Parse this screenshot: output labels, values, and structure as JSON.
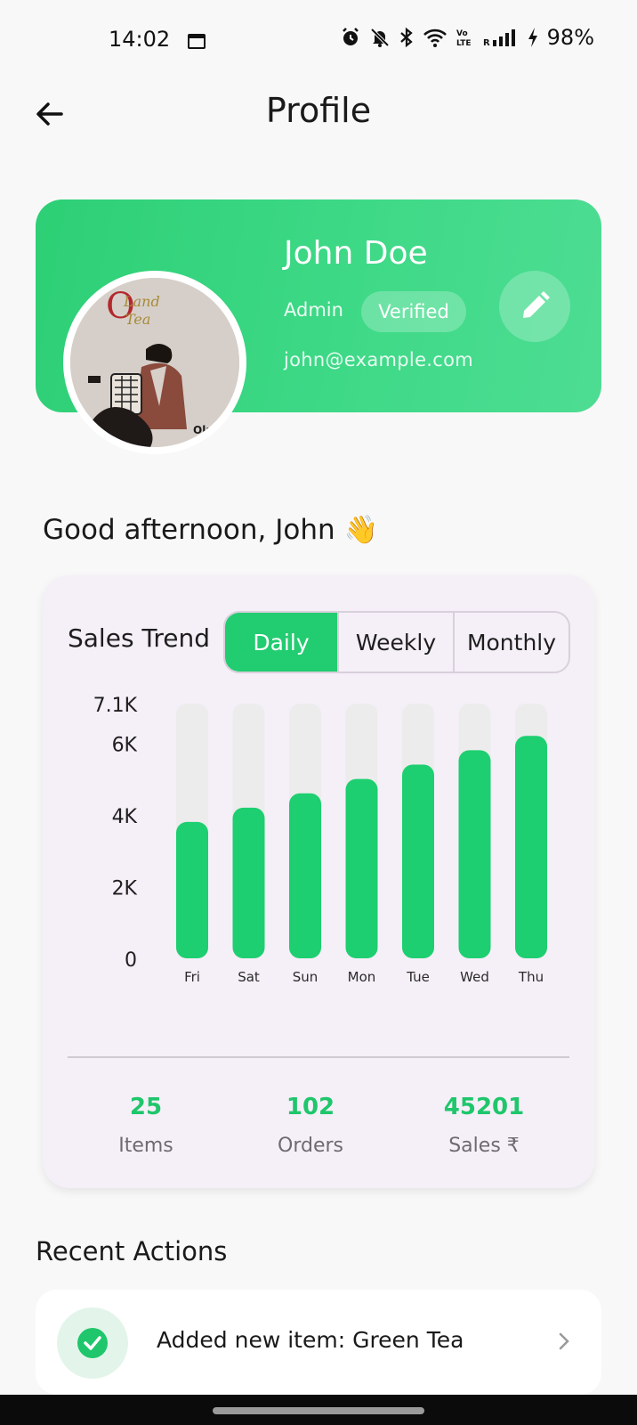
{
  "status_bar": {
    "time": "14:02",
    "battery": "98%",
    "icons": [
      "calendar-icon",
      "alarm-icon",
      "mute-icon",
      "bluetooth-icon",
      "wifi-icon",
      "volte-icon",
      "signal-icon",
      "charging-icon"
    ]
  },
  "header": {
    "title": "Profile",
    "back_icon": "arrow-left-icon"
  },
  "profile": {
    "name": "John Doe",
    "role": "Admin",
    "badge": "Verified",
    "email": "john@example.com",
    "edit_icon": "pencil-icon",
    "accent_color": "#2ecf77"
  },
  "greeting": "Good afternoon, John 👋",
  "sales_trend": {
    "title": "Sales Trend",
    "tabs": [
      {
        "label": "Daily",
        "active": true
      },
      {
        "label": "Weekly",
        "active": false
      },
      {
        "label": "Monthly",
        "active": false
      }
    ]
  },
  "chart_data": {
    "type": "bar",
    "categories": [
      "Fri",
      "Sat",
      "Sun",
      "Mon",
      "Tue",
      "Wed",
      "Thu"
    ],
    "values": [
      3800,
      4200,
      4600,
      5000,
      5400,
      5800,
      6200
    ],
    "y_ticks": [
      "0",
      "2K",
      "4K",
      "6K",
      "7.1K"
    ],
    "y_tick_values": [
      0,
      2000,
      4000,
      6000,
      7100
    ],
    "ylim": [
      0,
      7100
    ],
    "grid": false,
    "bar_color": "#1dcf70",
    "track_color": "#ececec"
  },
  "stats": [
    {
      "value": "25",
      "label": "Items"
    },
    {
      "value": "102",
      "label": "Orders"
    },
    {
      "value": "45201",
      "label": "Sales ₹"
    }
  ],
  "recent_actions": {
    "title": "Recent Actions",
    "items": [
      {
        "text": "Added new item: Green Tea",
        "icon": "check-circle-icon"
      }
    ]
  }
}
